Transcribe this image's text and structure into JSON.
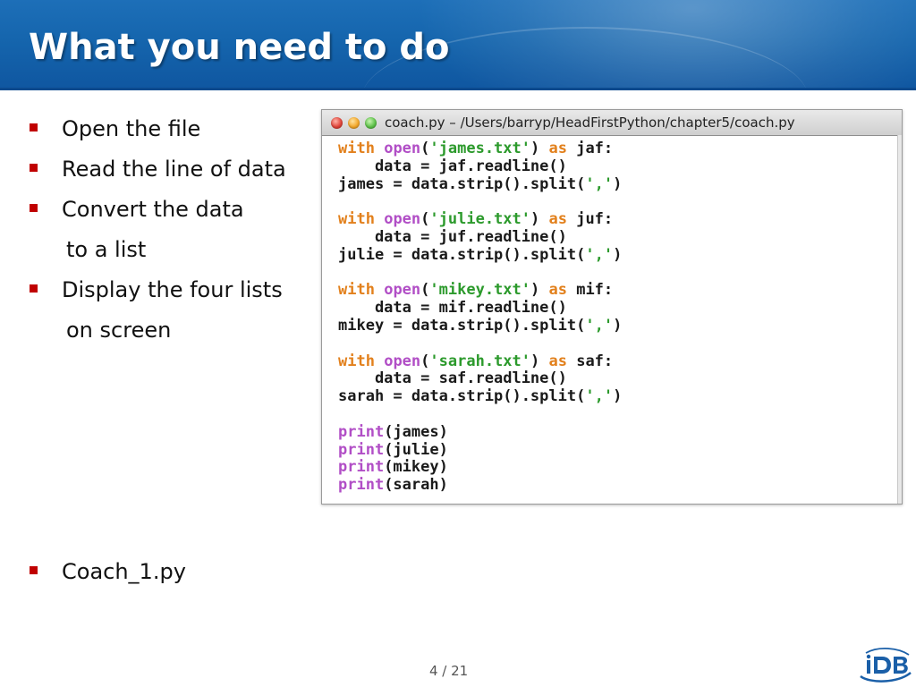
{
  "slide": {
    "title": "What you need to do",
    "bullets": [
      {
        "text": "Open the file"
      },
      {
        "text": "Read the line of data"
      },
      {
        "text": "Convert the data",
        "continuation": "to a list"
      },
      {
        "text": "Display the four lists",
        "continuation": "on screen"
      },
      {
        "text": "Coach_1.py"
      }
    ],
    "page_number": "4 / 21"
  },
  "code_window": {
    "title": "coach.py – /Users/barryp/HeadFirstPython/chapter5/coach.py",
    "blocks": [
      {
        "file": "'james.txt'",
        "handle": "jaf",
        "var": "james"
      },
      {
        "file": "'julie.txt'",
        "handle": "juf",
        "var": "julie"
      },
      {
        "file": "'mikey.txt'",
        "handle": "mif",
        "var": "mikey"
      },
      {
        "file": "'sarah.txt'",
        "handle": "saf",
        "var": "sarah"
      }
    ],
    "prints": [
      "james",
      "julie",
      "mikey",
      "sarah"
    ]
  },
  "colors": {
    "header_blue": "#1565ad",
    "bullet_red": "#c00000",
    "keyword_orange": "#e2801c",
    "builtin_purple": "#b14ec6",
    "string_green": "#2c9a2c"
  },
  "icons": {
    "logo": "idb-logo"
  }
}
